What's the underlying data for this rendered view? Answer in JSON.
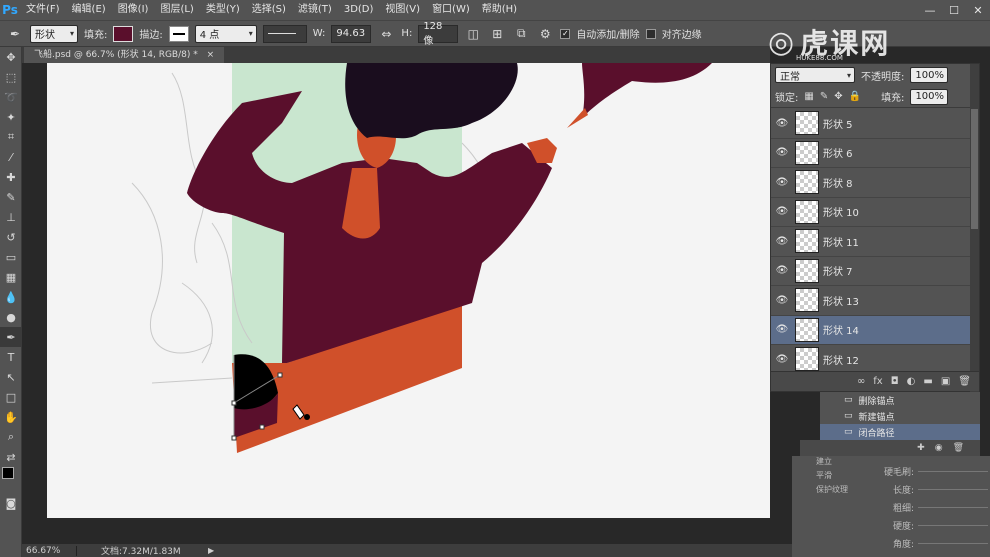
{
  "app": {
    "logo": "Ps",
    "menu": [
      "文件(F)",
      "编辑(E)",
      "图像(I)",
      "图层(L)",
      "类型(Y)",
      "选择(S)",
      "滤镜(T)",
      "3D(D)",
      "视图(V)",
      "窗口(W)",
      "帮助(H)"
    ],
    "window_controls": [
      "—",
      "☐",
      "✕"
    ]
  },
  "options": {
    "tool_mode": "形状",
    "fill_label": "填充:",
    "fill_color": "#5a0f2c",
    "stroke_label": "描边:",
    "stroke_width": "4 点",
    "w_label": "W:",
    "w_value": "94.63",
    "link_icon": "link-icon",
    "h_label": "H:",
    "h_value": "128 像",
    "auto_add_delete": "自动添加/删除",
    "align_edges": "对齐边缘"
  },
  "document": {
    "tab_title": "飞船.psd @ 66.7% (形状 14, RGB/8) *",
    "tab_close": "×"
  },
  "layers_panel": {
    "blend_mode": "正常",
    "opacity_label": "不透明度:",
    "opacity_value": "100%",
    "lock_label": "锁定:",
    "fill_label": "填充:",
    "fill_value": "100%",
    "layers": [
      {
        "name": "形状 5",
        "selected": false
      },
      {
        "name": "形状 6",
        "selected": false
      },
      {
        "name": "形状 8",
        "selected": false
      },
      {
        "name": "形状 10",
        "selected": false
      },
      {
        "name": "形状 11",
        "selected": false
      },
      {
        "name": "形状 7",
        "selected": false
      },
      {
        "name": "形状 13",
        "selected": false
      },
      {
        "name": "形状 14",
        "selected": true
      },
      {
        "name": "形状 12",
        "selected": false
      }
    ],
    "footer_icons": [
      "∞",
      "fx",
      "◘",
      "◐",
      "▬",
      "▣",
      "🗑"
    ]
  },
  "paths_panel": {
    "rows": [
      {
        "name": "删除锚点",
        "selected": false
      },
      {
        "name": "新建锚点",
        "selected": false
      },
      {
        "name": "闭合路径",
        "selected": true
      }
    ]
  },
  "brush_panel": {
    "left_items": [
      "建立",
      "平滑",
      "保护纹理"
    ],
    "right_items": [
      "硬毛刷:",
      "长度:",
      "粗细:",
      "硬度:",
      "角度:"
    ]
  },
  "status": {
    "zoom": "66.67%",
    "doc_info": "文档:7.32M/1.83M",
    "arrow": "▶"
  },
  "watermark": {
    "text": "虎课网",
    "sub": "HUKE88.COM"
  },
  "colors": {
    "canvas_bg": "#f4f4f4",
    "window_green": "#c9e6cf",
    "shirt": "#5a0f2c",
    "hair": "#1a0d1e",
    "skin": "#d0502a",
    "selection": "#5c6d8a"
  }
}
